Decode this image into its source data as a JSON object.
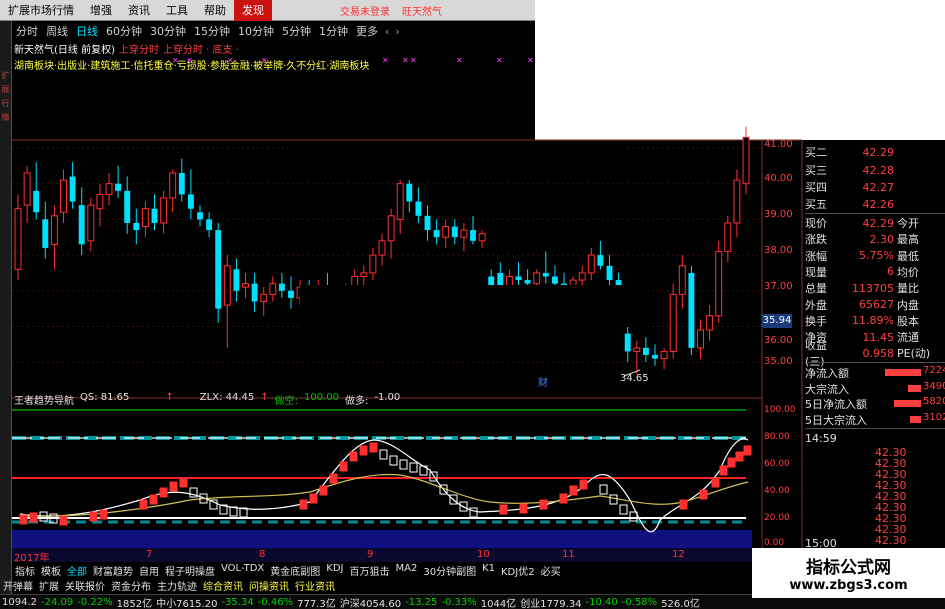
{
  "menubar": {
    "items": [
      "扩展市场行情",
      "增强",
      "资讯",
      "工具",
      "帮助",
      "发现"
    ],
    "active_index": 5,
    "ads": [
      "交易未登录",
      "旺天然气"
    ]
  },
  "period_bar": {
    "items": [
      "分时",
      "周线",
      "日线",
      "60分钟",
      "30分钟",
      "15分钟",
      "10分钟",
      "5分钟",
      "1分钟",
      "更多"
    ],
    "active_index": 2,
    "nav": [
      "‹",
      "›"
    ]
  },
  "stock_info": {
    "name": "新天然气(日线 前复权)",
    "tag1": "上穿分时",
    "tag2": "上穿分时 · 底支 ·",
    "concepts": "湖南板块·出版业·建筑施工·信托重仓·亏损股·参股金融·被举牌·久不分红·湖南板块"
  },
  "left_strip": [
    "扩",
    "展",
    "行",
    "情"
  ],
  "price_scale": {
    "ticks": [
      "41.00",
      "40.00",
      "39.00",
      "38.00",
      "37.00",
      "36.00",
      "35.00"
    ],
    "last_price": "35.94",
    "min_label": "34.65",
    "event_label": "财"
  },
  "indicator": {
    "name": "王者趋势导航",
    "qs": "QS: 81.65",
    "zlx": "ZLX: 44.45",
    "duokong_label": "做空:",
    "duokong_val": "100.00",
    "zuoduo_label": "做多:",
    "zuoduo_val": "-1.00",
    "ticks": [
      "100.00",
      "80.00",
      "60.00",
      "40.00",
      "20.00",
      "0.00"
    ]
  },
  "xaxis": {
    "labels": [
      "2017年",
      "7",
      "8",
      "9",
      "10",
      "11",
      "12"
    ]
  },
  "order_book": [
    {
      "label": "买二",
      "value": "42.29"
    },
    {
      "label": "买三",
      "value": "42.28"
    },
    {
      "label": "买四",
      "value": "42.27"
    },
    {
      "label": "买五",
      "value": "42.26"
    }
  ],
  "quote_rows": [
    {
      "l1": "现价",
      "v1": "42.29",
      "l2": "今开"
    },
    {
      "l1": "涨跌",
      "v1": "2.30",
      "l2": "最高"
    },
    {
      "l1": "涨幅",
      "v1": "5.75%",
      "l2": "最低"
    },
    {
      "l1": "现量",
      "v1": "6",
      "l2": "均价"
    },
    {
      "l1": "总量",
      "v1": "113705",
      "l2": "量比"
    },
    {
      "l1": "外盘",
      "v1": "65627",
      "l2": "内盘"
    },
    {
      "l1": "换手",
      "v1": "11.89%",
      "l2": "股本"
    },
    {
      "l1": "净资",
      "v1": "11.45",
      "l2": "流通"
    },
    {
      "l1": "收益(三)",
      "v1": "0.958",
      "l2": "PE(动)"
    }
  ],
  "capital_flow": [
    {
      "label": "净流入额",
      "value": "7224",
      "ratio": 0.95
    },
    {
      "label": "大宗流入",
      "value": "3490",
      "ratio": 0.35
    },
    {
      "label": "5日净流入额",
      "value": "5820",
      "ratio": 0.7
    },
    {
      "label": "5日大宗流入",
      "value": "3102",
      "ratio": 0.3
    }
  ],
  "ticks_panel": {
    "time_start": "14:59",
    "time_end": "15:00",
    "prices": [
      "42.30",
      "42.30",
      "42.30",
      "42.30",
      "42.30",
      "42.30",
      "42.30",
      "42.30",
      "42.30"
    ]
  },
  "tabs1": {
    "items": [
      "指标",
      "模板",
      "全部",
      "财富趋势",
      "自用",
      "程子明操盘",
      "VOL-TDX",
      "黄金底副图",
      "KDJ",
      "百万狙击",
      "MA2",
      "30分钟副图",
      "K1",
      "KDJ优2",
      "必买"
    ],
    "active_index": 2
  },
  "tabs2": {
    "items": [
      "开弹幕",
      "扩展",
      "关联报价",
      "资金分布",
      "主力轨迹",
      "综合资讯",
      "问操资讯",
      "行业资讯"
    ],
    "highlight": [
      5,
      6,
      7
    ]
  },
  "status": [
    {
      "t": "1094.2",
      "c": "sw"
    },
    {
      "t": "-24.09",
      "c": "sg"
    },
    {
      "t": "-0.22%",
      "c": "sg"
    },
    {
      "t": "1852亿",
      "c": "sw"
    },
    {
      "t": "中小7615.20",
      "c": "sw"
    },
    {
      "t": "-35.34",
      "c": "sg"
    },
    {
      "t": "-0.46%",
      "c": "sg"
    },
    {
      "t": "777.3亿",
      "c": "sw"
    },
    {
      "t": "沪深4054.60",
      "c": "sw"
    },
    {
      "t": "-13.25",
      "c": "sg"
    },
    {
      "t": "-0.33%",
      "c": "sg"
    },
    {
      "t": "1044亿",
      "c": "sw"
    },
    {
      "t": "创业1779.34",
      "c": "sw"
    },
    {
      "t": "-10.40",
      "c": "sg"
    },
    {
      "t": "-0.58%",
      "c": "sg"
    },
    {
      "t": "526.0亿",
      "c": "sw"
    }
  ],
  "watermark": {
    "title": "指标公式网",
    "url": "www.zbgs3.com"
  },
  "colors": {
    "up": "#ff3030",
    "down": "#00e0ff",
    "ma": "#e0e0e0"
  },
  "chart_data": {
    "type": "candlestick",
    "candles": [
      {
        "o": 37.6,
        "h": 39.7,
        "l": 37.3,
        "c": 39.3
      },
      {
        "o": 39.4,
        "h": 40.5,
        "l": 38.9,
        "c": 40.3
      },
      {
        "o": 39.8,
        "h": 40.6,
        "l": 39.0,
        "c": 39.2
      },
      {
        "o": 39.0,
        "h": 39.5,
        "l": 37.9,
        "c": 38.2
      },
      {
        "o": 38.3,
        "h": 39.4,
        "l": 37.6,
        "c": 39.1
      },
      {
        "o": 39.2,
        "h": 40.4,
        "l": 38.9,
        "c": 40.1
      },
      {
        "o": 40.2,
        "h": 40.6,
        "l": 39.3,
        "c": 39.5
      },
      {
        "o": 39.4,
        "h": 39.9,
        "l": 38.0,
        "c": 38.3
      },
      {
        "o": 38.4,
        "h": 39.6,
        "l": 38.1,
        "c": 39.4
      },
      {
        "o": 39.3,
        "h": 40.0,
        "l": 38.8,
        "c": 39.7
      },
      {
        "o": 39.7,
        "h": 40.3,
        "l": 39.4,
        "c": 40.0
      },
      {
        "o": 40.0,
        "h": 40.5,
        "l": 39.6,
        "c": 39.8
      },
      {
        "o": 39.8,
        "h": 40.2,
        "l": 38.6,
        "c": 38.9
      },
      {
        "o": 38.9,
        "h": 39.3,
        "l": 38.3,
        "c": 38.7
      },
      {
        "o": 38.8,
        "h": 39.5,
        "l": 38.5,
        "c": 39.3
      },
      {
        "o": 39.3,
        "h": 39.7,
        "l": 38.7,
        "c": 38.9
      },
      {
        "o": 38.9,
        "h": 39.8,
        "l": 38.6,
        "c": 39.6
      },
      {
        "o": 39.6,
        "h": 40.4,
        "l": 39.2,
        "c": 40.3
      },
      {
        "o": 40.3,
        "h": 40.7,
        "l": 39.5,
        "c": 39.7
      },
      {
        "o": 39.7,
        "h": 40.4,
        "l": 39.0,
        "c": 39.3
      },
      {
        "o": 39.2,
        "h": 39.4,
        "l": 38.8,
        "c": 39.0
      },
      {
        "o": 39.0,
        "h": 39.2,
        "l": 38.5,
        "c": 38.7
      },
      {
        "o": 38.7,
        "h": 38.9,
        "l": 36.1,
        "c": 36.5
      },
      {
        "o": 36.6,
        "h": 38.0,
        "l": 35.4,
        "c": 37.7
      },
      {
        "o": 37.6,
        "h": 37.9,
        "l": 36.7,
        "c": 37.0
      },
      {
        "o": 37.1,
        "h": 37.5,
        "l": 36.8,
        "c": 37.2
      },
      {
        "o": 37.2,
        "h": 37.5,
        "l": 36.4,
        "c": 36.7
      },
      {
        "o": 36.7,
        "h": 37.1,
        "l": 36.3,
        "c": 36.9
      },
      {
        "o": 36.9,
        "h": 37.4,
        "l": 36.7,
        "c": 37.2
      },
      {
        "o": 37.2,
        "h": 37.5,
        "l": 36.8,
        "c": 37.0
      },
      {
        "o": 37.0,
        "h": 37.4,
        "l": 36.5,
        "c": 36.8
      },
      {
        "o": 36.8,
        "h": 37.3,
        "l": 36.6,
        "c": 37.1
      },
      {
        "o": 37.1,
        "h": 37.3,
        "l": 36.6,
        "c": 36.9
      },
      {
        "o": 36.9,
        "h": 37.3,
        "l": 36.6,
        "c": 37.1
      },
      {
        "o": 37.1,
        "h": 37.5,
        "l": 36.6,
        "c": 36.8
      },
      {
        "o": 36.8,
        "h": 37.1,
        "l": 36.4,
        "c": 36.9
      },
      {
        "o": 36.9,
        "h": 37.2,
        "l": 36.6,
        "c": 37.0
      },
      {
        "o": 37.0,
        "h": 37.6,
        "l": 36.8,
        "c": 37.4
      },
      {
        "o": 37.4,
        "h": 37.7,
        "l": 37.1,
        "c": 37.5
      },
      {
        "o": 37.5,
        "h": 38.2,
        "l": 37.3,
        "c": 38.0
      },
      {
        "o": 38.0,
        "h": 38.6,
        "l": 37.7,
        "c": 38.4
      },
      {
        "o": 38.4,
        "h": 39.3,
        "l": 37.9,
        "c": 39.1
      },
      {
        "o": 39.0,
        "h": 40.3,
        "l": 38.6,
        "c": 40.0
      },
      {
        "o": 40.0,
        "h": 40.9,
        "l": 39.2,
        "c": 39.5
      },
      {
        "o": 39.5,
        "h": 39.9,
        "l": 38.9,
        "c": 39.1
      },
      {
        "o": 39.1,
        "h": 39.4,
        "l": 38.4,
        "c": 38.7
      },
      {
        "o": 38.7,
        "h": 39.0,
        "l": 38.3,
        "c": 38.5
      },
      {
        "o": 38.5,
        "h": 39.0,
        "l": 38.2,
        "c": 38.8
      },
      {
        "o": 38.8,
        "h": 39.0,
        "l": 38.3,
        "c": 38.5
      },
      {
        "o": 38.5,
        "h": 38.9,
        "l": 38.1,
        "c": 38.7
      },
      {
        "o": 38.7,
        "h": 39.1,
        "l": 38.3,
        "c": 38.4
      },
      {
        "o": 38.4,
        "h": 38.7,
        "l": 38.2,
        "c": 38.6
      },
      {
        "o": 37.4,
        "h": 37.6,
        "l": 36.9,
        "c": 37.0
      },
      {
        "o": 37.5,
        "h": 37.8,
        "l": 37.0,
        "c": 37.1
      },
      {
        "o": 37.1,
        "h": 37.6,
        "l": 36.9,
        "c": 37.4
      },
      {
        "o": 37.4,
        "h": 37.8,
        "l": 37.0,
        "c": 37.3
      },
      {
        "o": 37.3,
        "h": 37.6,
        "l": 37.0,
        "c": 37.2
      },
      {
        "o": 37.2,
        "h": 37.6,
        "l": 37.0,
        "c": 37.5
      },
      {
        "o": 37.5,
        "h": 38.1,
        "l": 37.2,
        "c": 37.4
      },
      {
        "o": 37.4,
        "h": 37.7,
        "l": 37.0,
        "c": 37.2
      },
      {
        "o": 37.2,
        "h": 37.5,
        "l": 36.9,
        "c": 37.0
      },
      {
        "o": 37.0,
        "h": 37.4,
        "l": 36.8,
        "c": 37.3
      },
      {
        "o": 37.3,
        "h": 37.7,
        "l": 37.0,
        "c": 37.5
      },
      {
        "o": 37.5,
        "h": 38.2,
        "l": 37.3,
        "c": 38.0
      },
      {
        "o": 38.0,
        "h": 38.4,
        "l": 37.6,
        "c": 37.7
      },
      {
        "o": 37.7,
        "h": 38.0,
        "l": 37.1,
        "c": 37.3
      },
      {
        "o": 37.3,
        "h": 37.5,
        "l": 36.9,
        "c": 37.0
      },
      {
        "o": 35.8,
        "h": 36.1,
        "l": 35.0,
        "c": 35.3
      },
      {
        "o": 35.3,
        "h": 35.6,
        "l": 34.65,
        "c": 35.4
      },
      {
        "o": 35.4,
        "h": 35.7,
        "l": 35.0,
        "c": 35.2
      },
      {
        "o": 35.2,
        "h": 35.5,
        "l": 34.9,
        "c": 35.1
      },
      {
        "o": 35.1,
        "h": 35.4,
        "l": 34.8,
        "c": 35.3
      },
      {
        "o": 35.3,
        "h": 37.2,
        "l": 35.1,
        "c": 36.9
      },
      {
        "o": 36.9,
        "h": 38.0,
        "l": 36.5,
        "c": 37.7
      },
      {
        "o": 37.5,
        "h": 37.7,
        "l": 35.2,
        "c": 35.4
      },
      {
        "o": 35.4,
        "h": 36.2,
        "l": 35.1,
        "c": 35.9
      },
      {
        "o": 35.9,
        "h": 36.6,
        "l": 35.6,
        "c": 36.3
      },
      {
        "o": 36.3,
        "h": 38.4,
        "l": 36.1,
        "c": 38.1
      },
      {
        "o": 38.1,
        "h": 39.1,
        "l": 37.8,
        "c": 38.9
      },
      {
        "o": 38.9,
        "h": 40.4,
        "l": 38.5,
        "c": 40.1
      },
      {
        "o": 40.0,
        "h": 41.6,
        "l": 39.7,
        "c": 41.3
      }
    ]
  }
}
